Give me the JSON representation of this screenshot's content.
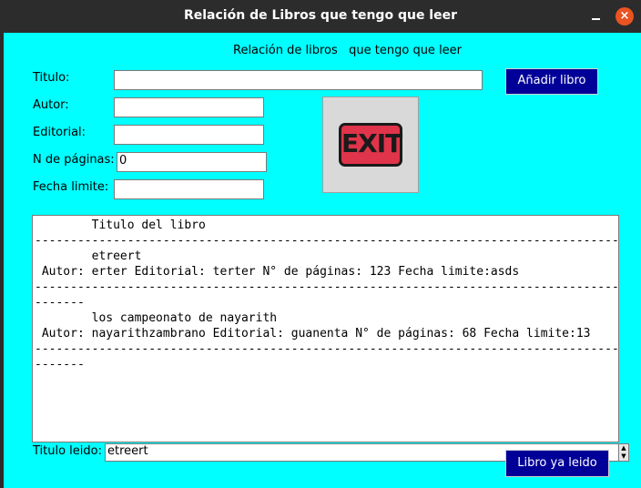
{
  "window": {
    "title": "Relación de Libros que tengo que leer",
    "minimize_icon": "minimize-icon",
    "close_icon": "close-icon",
    "close_glyph": "×",
    "accent_color": "#e95420"
  },
  "colors": {
    "background": "#00ffff",
    "button_bg": "#000099",
    "button_fg": "#ffffff"
  },
  "header": {
    "text": "Relación de libros   que tengo que leer"
  },
  "form": {
    "titulo_label": "Titulo:",
    "titulo_value": "",
    "autor_label": "Autor:",
    "autor_value": "",
    "editorial_label": "Editorial:",
    "editorial_value": "",
    "paginas_label": "N de páginas:",
    "paginas_value": "0",
    "fecha_label": "Fecha limite:",
    "fecha_value": ""
  },
  "buttons": {
    "add_label": "Añadir libro",
    "exit_label": "EXIT",
    "exit_icon": "exit-sign-icon",
    "read_label": "Libro ya leido"
  },
  "book_list": {
    "lines": [
      "        Titulo del libro",
      "-------------------------------------------------------------------------------------",
      "        etreert",
      " Autor: erter Editorial: terter N° de páginas: 123 Fecha limite:asds",
      "--------------------------------------------------------------------------------------------------",
      "        los campeonato de nayarith",
      " Autor: nayarithzambrano Editorial: guanenta N° de páginas: 68 Fecha limite:13",
      "--------------------------------------------------------------------------------------------------"
    ]
  },
  "footer": {
    "titulo_leido_label": "Titulo leido:",
    "titulo_leido_value": "etreert",
    "spinner_icon": "spinner-arrows-icon"
  }
}
